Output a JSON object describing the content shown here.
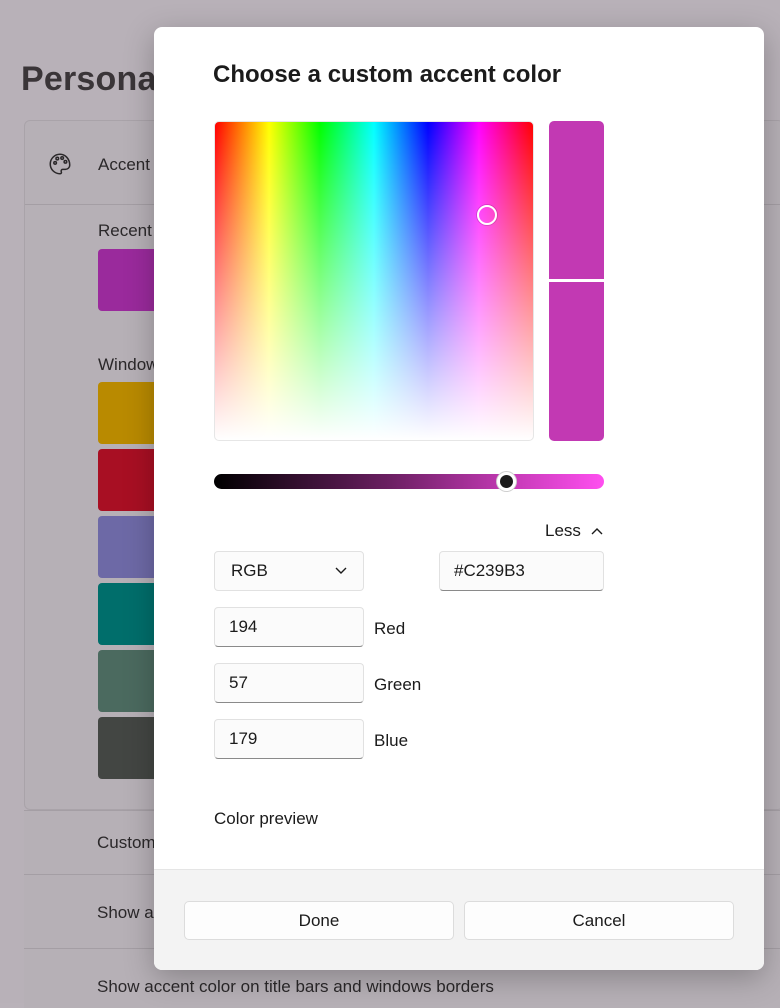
{
  "background": {
    "page_title": "Personal",
    "accent_label": "Accent",
    "recent_label": "Recent",
    "windows_label": "Window",
    "recent_swatch_color": "#9a2a9c",
    "windows_swatches": [
      "#b98a00",
      "#a80f23",
      "#6d69a6",
      "#006e6b",
      "#4b6a5f",
      "#434643"
    ],
    "custom_label": "Custom",
    "show_accent_start_label": "Show a",
    "show_accent_titlebar_label": "Show accent color on title bars and windows borders"
  },
  "dialog": {
    "title": "Choose a custom accent color",
    "selected_color": "#C239B3",
    "less_label": "Less",
    "mode": "RGB",
    "hex_value": "#C239B3",
    "red_value": "194",
    "green_value": "57",
    "blue_value": "179",
    "red_label": "Red",
    "green_label": "Green",
    "blue_label": "Blue",
    "color_preview_label": "Color preview",
    "done_label": "Done",
    "cancel_label": "Cancel",
    "value_level": 0.75
  }
}
